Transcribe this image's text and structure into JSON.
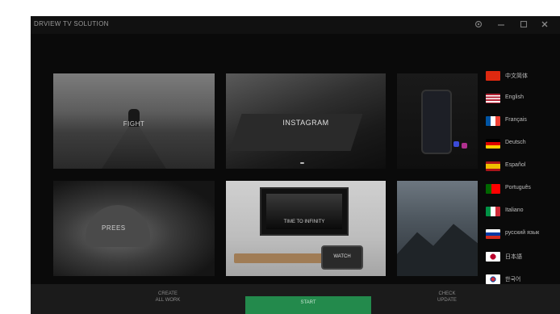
{
  "window": {
    "title": "DRVIEW TV  SOLUTION",
    "controls": [
      "settings-icon",
      "minimize-icon",
      "maximize-icon",
      "close-icon"
    ]
  },
  "tiles": [
    {
      "id": "t1",
      "label": "FIGHT"
    },
    {
      "id": "t2",
      "label": "INSTAGRAM"
    },
    {
      "id": "t3",
      "label": ""
    },
    {
      "id": "t4",
      "label": "PREES"
    },
    {
      "id": "t5",
      "tv_caption": "TIME TO INFINITY",
      "phone_label": "WATCH"
    },
    {
      "id": "t6",
      "label": ""
    }
  ],
  "languages": [
    {
      "label": "中文简体",
      "colors": [
        "#de2910",
        "#ffde00"
      ]
    },
    {
      "label": "English",
      "colors": [
        "#b22234",
        "#ffffff",
        "#3c3b6e"
      ]
    },
    {
      "label": "Français",
      "colors": [
        "#0055a4",
        "#ffffff",
        "#ef4135"
      ]
    },
    {
      "label": "Deutsch",
      "colors": [
        "#000000",
        "#dd0000",
        "#ffce00"
      ]
    },
    {
      "label": "Español",
      "colors": [
        "#aa151b",
        "#f1bf00",
        "#aa151b"
      ]
    },
    {
      "label": "Português",
      "colors": [
        "#006600",
        "#ff0000"
      ]
    },
    {
      "label": "Italiano",
      "colors": [
        "#009246",
        "#ffffff",
        "#ce2b37"
      ]
    },
    {
      "label": "русский язык",
      "colors": [
        "#ffffff",
        "#0039a6",
        "#d52b1e"
      ]
    },
    {
      "label": "日本語",
      "colors": [
        "#ffffff",
        "#bc002d"
      ]
    },
    {
      "label": "한국어",
      "colors": [
        "#ffffff",
        "#cd2e3a",
        "#0047a0"
      ]
    }
  ],
  "bottombar": {
    "left": {
      "line1": "CREATE",
      "line2": "ALL WORK"
    },
    "primary": {
      "label": "START"
    },
    "right": {
      "line1": "CHECK",
      "line2": "UPDATE"
    }
  }
}
